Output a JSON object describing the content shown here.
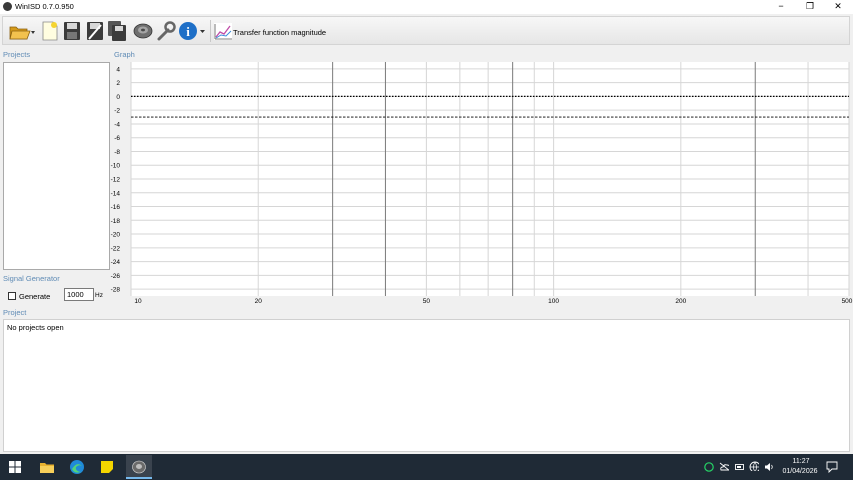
{
  "window": {
    "title": "WinISD 0.7.0.950",
    "minimize_glyph": "−",
    "maximize_glyph": "❐",
    "close_glyph": "✕"
  },
  "toolbar": {
    "graph_type_label": "Transfer function magnitude",
    "icons": [
      "open-folder-icon",
      "new-project-icon",
      "save-icon",
      "save-as-icon",
      "save-all-icon",
      "driver-icon",
      "tools-wrench-icon",
      "info-icon",
      "graph-icon"
    ]
  },
  "sections": {
    "projects": "Projects",
    "graph": "Graph",
    "signal_generator": "Signal Generator",
    "project": "Project"
  },
  "signal_generator": {
    "generate_label": "Generate",
    "generate_checked": false,
    "frequency_value": "1000",
    "frequency_unit": "Hz"
  },
  "project": {
    "status": "No projects open"
  },
  "chart_data": {
    "type": "line",
    "x_scale": "log",
    "xlim": [
      10,
      500
    ],
    "ylim": [
      -29,
      5
    ],
    "x_tick_labels": [
      "10",
      "20",
      "50",
      "100",
      "200",
      "500"
    ],
    "x_ticks": [
      10,
      20,
      50,
      100,
      200,
      500
    ],
    "y_ticks": [
      4,
      2,
      0,
      -2,
      -4,
      -6,
      -8,
      -10,
      -12,
      -14,
      -16,
      -18,
      -20,
      -22,
      -24,
      -26,
      -28
    ],
    "y_tick_labels": [
      "4",
      "2",
      "0",
      "-2",
      "-4",
      "-6",
      "-8",
      "-10",
      "-12",
      "-14",
      "-16",
      "-18",
      "-20",
      "-22",
      "-24",
      "-26",
      "-28"
    ],
    "reference_lines": [
      {
        "y": 0,
        "style": "dotted"
      },
      {
        "y": -3,
        "style": "dashed"
      }
    ],
    "grid": true,
    "series": []
  },
  "taskbar": {
    "apps": [
      "windows-start-icon",
      "file-explorer-icon",
      "edge-browser-icon",
      "sticky-notes-icon",
      "winisd-taskbar-icon"
    ],
    "tray": [
      "whatsapp-icon",
      "onedrive-icon",
      "battery-icon",
      "network-icon",
      "volume-icon"
    ],
    "time": "11:27",
    "date": "01/04/2026"
  },
  "colors": {
    "section_label": "#5f8bb5",
    "taskbar": "#1f2a36",
    "grid_minor": "#d6d6d6",
    "grid_major": "#7a7a7a"
  }
}
